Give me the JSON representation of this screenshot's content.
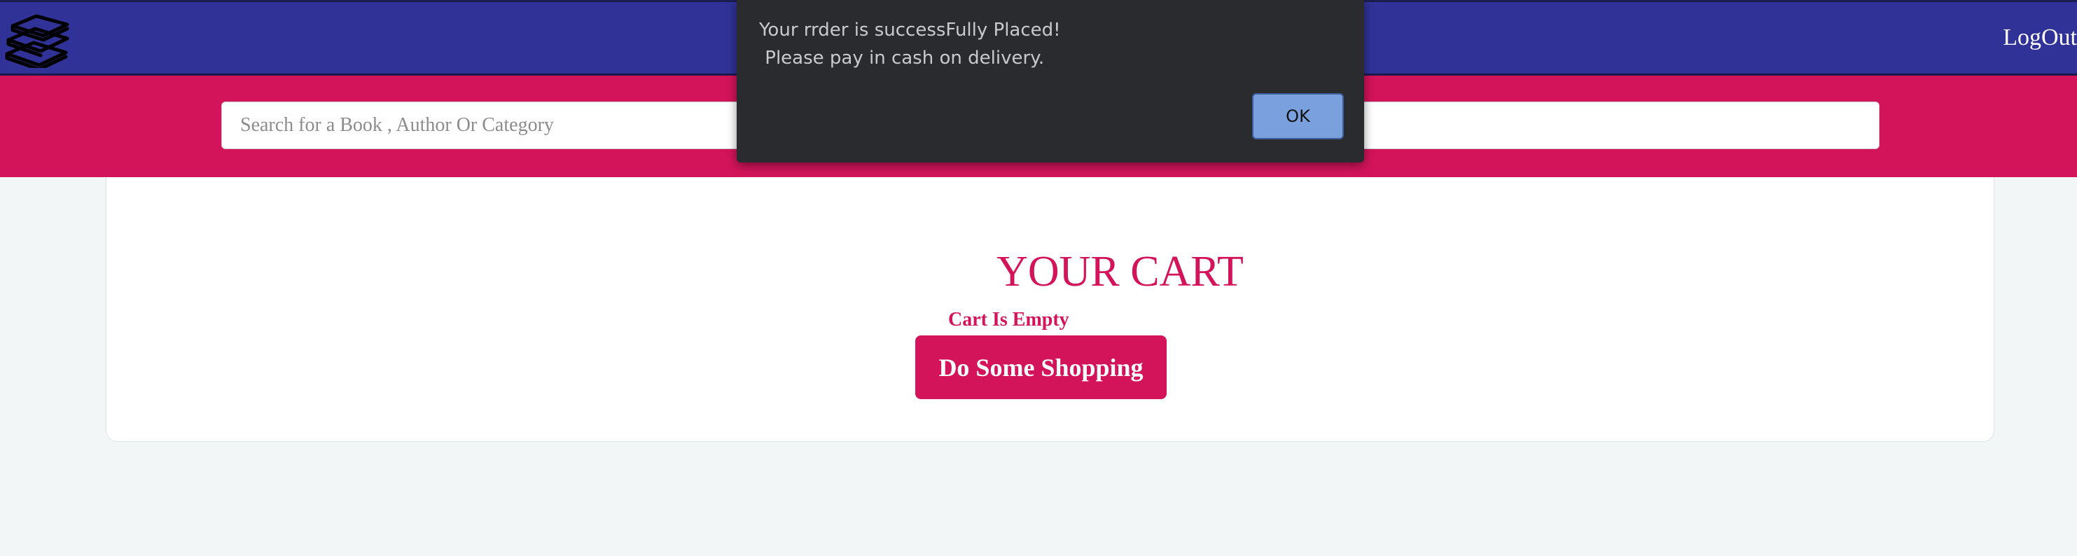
{
  "navbar": {
    "logo_icon": "books-stack-icon",
    "logout_label": "LogOut"
  },
  "search": {
    "placeholder": "Search for a Book , Author Or Category",
    "value": ""
  },
  "cart": {
    "title": "YOUR CART",
    "empty_message": "Cart Is Empty",
    "shop_button_label": "Do Some Shopping"
  },
  "dialog": {
    "message_line1": "Your rrder is successFully Placed!",
    "message_line2": " Please pay in cash on delivery.",
    "ok_label": "OK"
  },
  "colors": {
    "navbar": "#303297",
    "accent": "#d3145a",
    "page_background": "#f3f6f7",
    "dialog_background": "#2a2b2e",
    "ok_button": "#7aa0dd"
  }
}
